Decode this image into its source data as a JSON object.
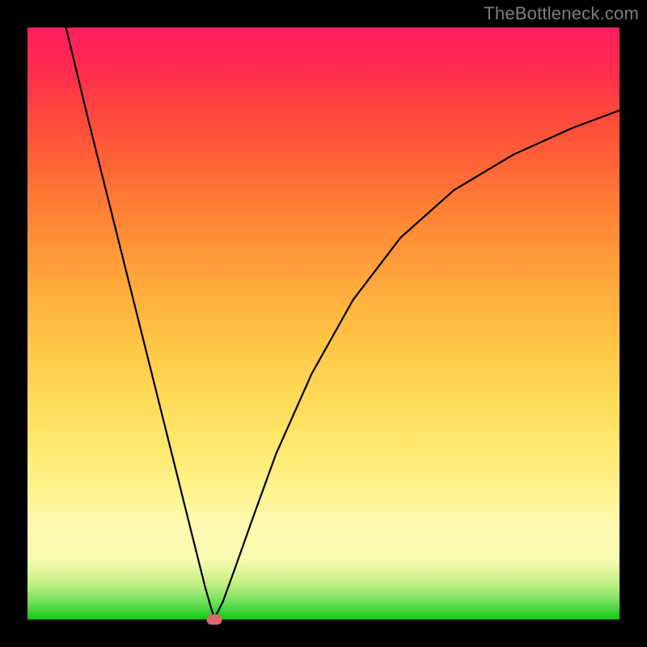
{
  "watermark": "TheBottleneck.com",
  "chart_data": {
    "type": "line",
    "title": "",
    "xlabel": "",
    "ylabel": "",
    "xlim": [
      0,
      1
    ],
    "ylim": [
      0,
      1
    ],
    "background_gradient": {
      "bottom": "#12c913",
      "mid_low": "#fff38c",
      "mid_high": "#ff9838",
      "top": "#ff1f5d"
    },
    "series": [
      {
        "name": "curve",
        "x": [
          0.065,
          0.1,
          0.15,
          0.2,
          0.25,
          0.28,
          0.3,
          0.31,
          0.315,
          0.32,
          0.33,
          0.35,
          0.38,
          0.42,
          0.48,
          0.55,
          0.63,
          0.72,
          0.82,
          0.92,
          1.0
        ],
        "y": [
          1.0,
          0.855,
          0.655,
          0.455,
          0.255,
          0.135,
          0.055,
          0.02,
          0.005,
          0.01,
          0.03,
          0.085,
          0.17,
          0.28,
          0.415,
          0.54,
          0.645,
          0.725,
          0.785,
          0.83,
          0.86
        ]
      }
    ],
    "marker": {
      "x": 0.315,
      "y": 0.0
    },
    "frame_color": "#000000"
  }
}
